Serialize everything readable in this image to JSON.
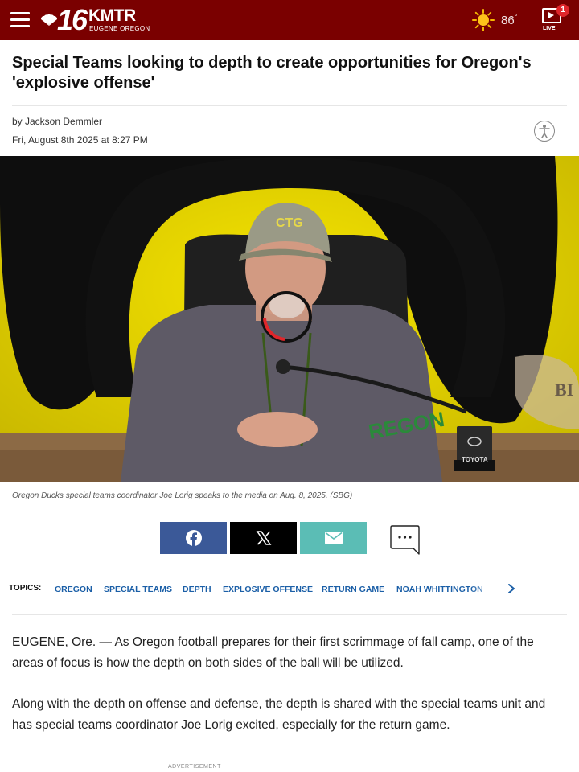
{
  "header": {
    "logo_number": "16",
    "logo_call": "KMTR",
    "logo_city": "EUGENE OREGON",
    "temperature": "86",
    "temperature_unit": "°",
    "live_label": "LIVE",
    "live_badge": "1",
    "background_color": "#7a0000"
  },
  "article": {
    "headline": "Special Teams looking to depth to create opportunities for Oregon's 'explosive offense'",
    "byline": "by Jackson Demmler",
    "date": "Fri, August 8th 2025 at 8:27 PM",
    "photo_text": {
      "backdrop_letters": "BI",
      "nameplate": "TOYOTA",
      "cap_logo": "CTG",
      "shirt_text": "REGON"
    },
    "caption": "Oregon Ducks special teams coordinator Joe Lorig speaks to the media on Aug. 8, 2025. (SBG)",
    "share": {
      "facebook_icon": "facebook-icon",
      "x_icon": "x-icon",
      "email_icon": "email-icon",
      "comments_icon": "comments-icon",
      "colors": {
        "facebook": "#3b5998",
        "x": "#000000",
        "email": "#5bbdb5"
      }
    },
    "topics_label": "TOPICS:",
    "topics": [
      "OREGON",
      "SPECIAL TEAMS",
      "DEPTH",
      "EXPLOSIVE OFFENSE",
      "RETURN GAME",
      "NOAH WHITTINGTON"
    ],
    "paragraphs": [
      "EUGENE, Ore. — As Oregon football prepares for their first scrimmage of fall camp, one of the areas of focus is how the depth on both sides of the ball will be utilized.",
      "Along with the depth on offense and defense, the depth is shared with the special teams unit and has special teams coordinator Joe Lorig excited, especially for the return game."
    ],
    "advertisement_label": "ADVERTISEMENT"
  }
}
